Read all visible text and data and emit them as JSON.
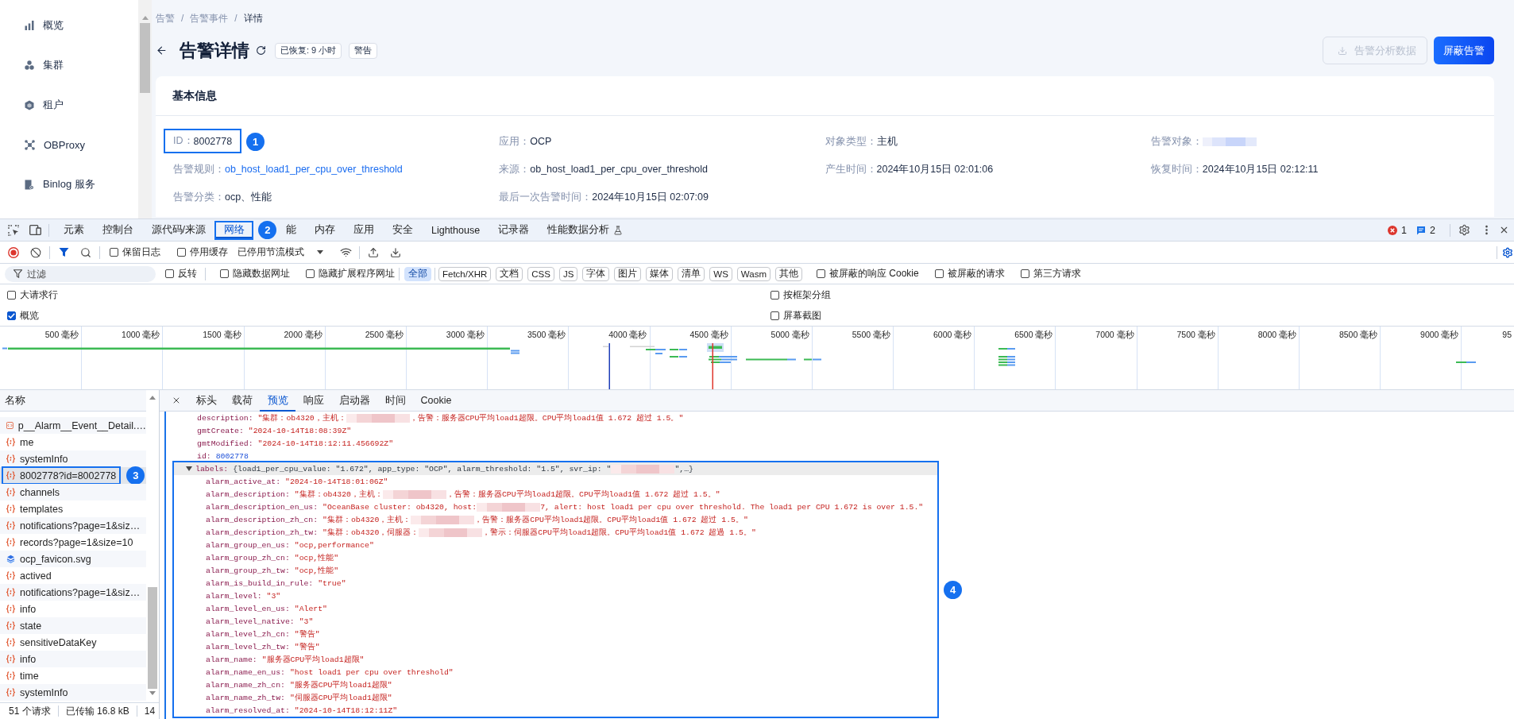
{
  "sidebar": {
    "items": [
      {
        "label": "概览",
        "selected": false
      },
      {
        "label": "集群",
        "selected": false
      },
      {
        "label": "租户",
        "selected": false
      },
      {
        "label": "OBProxy",
        "selected": false
      },
      {
        "label": "Binlog 服务",
        "selected": false
      }
    ]
  },
  "breadcrumb": {
    "items": [
      "告警",
      "告警事件",
      "详情"
    ],
    "separator": "/"
  },
  "header": {
    "title": "告警详情",
    "tags": [
      "已恢复: 9 小时",
      "警告"
    ],
    "actions": [
      {
        "label": "告警分析数据",
        "kind": "default",
        "disabled": true
      },
      {
        "label": "屏蔽告警",
        "kind": "primary",
        "disabled": false
      }
    ]
  },
  "basic_info": {
    "title": "基本信息",
    "fields": [
      {
        "label": "ID：",
        "value": "8002778",
        "kind": "text",
        "callout": "1"
      },
      {
        "label": "应用：",
        "value": "OCP",
        "kind": "text"
      },
      {
        "label": "对象类型：",
        "value": "主机",
        "kind": "text"
      },
      {
        "label": "告警对象：",
        "kind": "redacted"
      },
      {
        "label": "告警规则：",
        "value": "ob_host_load1_per_cpu_over_threshold",
        "kind": "link"
      },
      {
        "label": "来源：",
        "value": "ob_host_load1_per_cpu_over_threshold",
        "kind": "text"
      },
      {
        "label": "产生时间：",
        "value": "2024年10月15日 02:01:06",
        "kind": "text"
      },
      {
        "label": "恢复时间：",
        "value": "2024年10月15日 02:12:11",
        "kind": "text"
      },
      {
        "label": "告警分类：",
        "value": "ocp、性能",
        "kind": "text"
      },
      {
        "label": "最后一次告警时间：",
        "value": "2024年10月15日 02:07:09",
        "kind": "text"
      }
    ]
  },
  "devtools": {
    "tabs": [
      {
        "label": "元素",
        "selected": false,
        "kind": "plain"
      },
      {
        "label": "控制台",
        "selected": false,
        "kind": "plain"
      },
      {
        "label": "源代码/来源",
        "selected": false,
        "kind": "plain"
      },
      {
        "label": "网络",
        "selected": true,
        "kind": "plain",
        "callout": "2"
      },
      {
        "label": "能",
        "selected": false,
        "kind": "plain"
      },
      {
        "label": "内存",
        "selected": false,
        "kind": "plain"
      },
      {
        "label": "应用",
        "selected": false,
        "kind": "plain"
      },
      {
        "label": "安全",
        "selected": false,
        "kind": "plain"
      },
      {
        "label": "Lighthouse",
        "selected": false,
        "kind": "plain"
      },
      {
        "label": "记录器",
        "selected": false,
        "kind": "plain"
      },
      {
        "label": "性能数据分析",
        "selected": false,
        "kind": "experimental"
      }
    ],
    "issue_counts": {
      "errors": "1",
      "messages": "2"
    },
    "toolbar": {
      "options": [
        {
          "label": "保留日志",
          "checked": false
        },
        {
          "label": "停用缓存",
          "checked": false
        }
      ],
      "throttling": "已停用节流模式"
    },
    "filter_bar": {
      "placeholder": "过滤",
      "options": [
        {
          "label": "反转",
          "checked": false
        },
        {
          "label": "隐藏数据网址",
          "checked": false
        },
        {
          "label": "隐藏扩展程序网址",
          "checked": false
        }
      ],
      "types": [
        {
          "label": "全部",
          "selected": true
        },
        {
          "label": "Fetch/XHR",
          "selected": false
        },
        {
          "label": "文档",
          "selected": false
        },
        {
          "label": "CSS",
          "selected": false
        },
        {
          "label": "JS",
          "selected": false
        },
        {
          "label": "字体",
          "selected": false
        },
        {
          "label": "图片",
          "selected": false
        },
        {
          "label": "媒体",
          "selected": false
        },
        {
          "label": "清单",
          "selected": false
        },
        {
          "label": "WS",
          "selected": false
        },
        {
          "label": "Wasm",
          "selected": false
        },
        {
          "label": "其他",
          "selected": false
        }
      ],
      "more_options": [
        {
          "label": "被屏蔽的响应 Cookie",
          "checked": false
        },
        {
          "label": "被屏蔽的请求",
          "checked": false
        },
        {
          "label": "第三方请求",
          "checked": false
        }
      ]
    },
    "settings": [
      {
        "label": "大请求行",
        "checked": false
      },
      {
        "label": "按框架分组",
        "checked": false
      },
      {
        "label": "概览",
        "checked": true
      },
      {
        "label": "屏幕截图",
        "checked": false
      }
    ],
    "overview": {
      "ticks": [
        "500 毫秒",
        "1000 毫秒",
        "1500 毫秒",
        "2000 毫秒",
        "2500 毫秒",
        "3000 毫秒",
        "3500 毫秒",
        "4000 毫秒",
        "4500 毫秒",
        "5000 毫秒",
        "5500 毫秒",
        "6000 毫秒",
        "6500 毫秒",
        "7000 毫秒",
        "7500 毫秒",
        "8000 毫秒",
        "8500 毫秒",
        "9000 毫秒",
        "95"
      ]
    },
    "requests": {
      "header": "名称",
      "rows": [
        {
          "name": "p__Alarm__Event__Detail.…",
          "kind": "script",
          "selected": false
        },
        {
          "name": "me",
          "kind": "fetch",
          "selected": false
        },
        {
          "name": "systemInfo",
          "kind": "fetch",
          "selected": false
        },
        {
          "name": "8002778?id=8002778",
          "kind": "fetch",
          "selected": true,
          "callout": "3"
        },
        {
          "name": "channels",
          "kind": "fetch",
          "selected": false
        },
        {
          "name": "templates",
          "kind": "fetch",
          "selected": false
        },
        {
          "name": "notifications?page=1&siz…",
          "kind": "fetch",
          "selected": false
        },
        {
          "name": "records?page=1&size=10",
          "kind": "fetch",
          "selected": false
        },
        {
          "name": "ocp_favicon.svg",
          "kind": "image",
          "selected": false
        },
        {
          "name": "actived",
          "kind": "fetch",
          "selected": false
        },
        {
          "name": "notifications?page=1&siz…",
          "kind": "fetch",
          "selected": false
        },
        {
          "name": "info",
          "kind": "fetch",
          "selected": false
        },
        {
          "name": "state",
          "kind": "fetch",
          "selected": false
        },
        {
          "name": "sensitiveDataKey",
          "kind": "fetch",
          "selected": false
        },
        {
          "name": "info",
          "kind": "fetch",
          "selected": false
        },
        {
          "name": "time",
          "kind": "fetch",
          "selected": false
        },
        {
          "name": "systemInfo",
          "kind": "fetch",
          "selected": false
        }
      ],
      "status": [
        "51 个请求",
        "已传输 16.8 kB",
        "14"
      ]
    },
    "preview": {
      "tabs": [
        {
          "label": "标头",
          "selected": false
        },
        {
          "label": "载荷",
          "selected": false
        },
        {
          "label": "预览",
          "selected": true
        },
        {
          "label": "响应",
          "selected": false
        },
        {
          "label": "启动器",
          "selected": false
        },
        {
          "label": "时间",
          "selected": false
        },
        {
          "label": "Cookie",
          "selected": false
        }
      ],
      "properties": [
        {
          "key": "description:",
          "selected": false,
          "parts": [
            {
              "kind": "string",
              "text": "\"集群：ob4320，主机："
            },
            {
              "kind": "redacted"
            },
            {
              "kind": "string",
              "text": "，告警：服务器CPU平均load1超限。CPU平均load1值 1.672 超过 1.5。\""
            }
          ]
        },
        {
          "key": "gmtCreate:",
          "selected": false,
          "parts": [
            {
              "kind": "string",
              "text": "\"2024-10-14T18:08:39Z\""
            }
          ]
        },
        {
          "key": "gmtModified:",
          "selected": false,
          "parts": [
            {
              "kind": "string",
              "text": "\"2024-10-14T18:12:11.456692Z\""
            }
          ]
        },
        {
          "key": "id:",
          "selected": false,
          "parts": [
            {
              "kind": "number",
              "text": "8002778"
            }
          ]
        },
        {
          "key": "labels:",
          "selected": true,
          "expanded": true,
          "callout": "4",
          "parts": [
            {
              "kind": "plain",
              "text": "{load1_per_cpu_value: \"1.672\", app_type: \"OCP\", alarm_threshold: \"1.5\", svr_ip: \""
            },
            {
              "kind": "redacted"
            },
            {
              "kind": "plain",
              "text": "\",…}"
            }
          ],
          "children": [
            {
              "key": "alarm_active_at:",
              "selected": false,
              "parts": [
                {
                  "kind": "string",
                  "text": "\"2024-10-14T18:01:06Z\""
                }
              ]
            },
            {
              "key": "alarm_description:",
              "selected": false,
              "parts": [
                {
                  "kind": "string",
                  "text": "\"集群：ob4320，主机："
                },
                {
                  "kind": "redacted"
                },
                {
                  "kind": "string",
                  "text": "，告警：服务器CPU平均load1超限。CPU平均load1值 1.672 超过 1.5。\""
                }
              ]
            },
            {
              "key": "alarm_description_en_us:",
              "selected": false,
              "parts": [
                {
                  "kind": "string",
                  "text": "\"OceanBase cluster: ob4320, host:"
                },
                {
                  "kind": "redacted"
                },
                {
                  "kind": "string",
                  "text": "7, alert: host load1 per cpu over threshold. The load1 per CPU 1.672 is over 1.5.\""
                }
              ]
            },
            {
              "key": "alarm_description_zh_cn:",
              "selected": false,
              "parts": [
                {
                  "kind": "string",
                  "text": "\"集群：ob4320，主机："
                },
                {
                  "kind": "redacted"
                },
                {
                  "kind": "string",
                  "text": "，告警：服务器CPU平均load1超限。CPU平均load1值 1.672 超过 1.5。\""
                }
              ]
            },
            {
              "key": "alarm_description_zh_tw:",
              "selected": false,
              "parts": [
                {
                  "kind": "string",
                  "text": "\"集群：ob4320，伺服器："
                },
                {
                  "kind": "redacted"
                },
                {
                  "kind": "string",
                  "text": "，警示：伺服器CPU平均load1超限。CPU平均load1值 1.672 超過 1.5。\""
                }
              ]
            },
            {
              "key": "alarm_group_en_us:",
              "selected": false,
              "parts": [
                {
                  "kind": "string",
                  "text": "\"ocp,performance\""
                }
              ]
            },
            {
              "key": "alarm_group_zh_cn:",
              "selected": false,
              "parts": [
                {
                  "kind": "string",
                  "text": "\"ocp,性能\""
                }
              ]
            },
            {
              "key": "alarm_group_zh_tw:",
              "selected": false,
              "parts": [
                {
                  "kind": "string",
                  "text": "\"ocp,性能\""
                }
              ]
            },
            {
              "key": "alarm_is_build_in_rule:",
              "selected": false,
              "parts": [
                {
                  "kind": "string",
                  "text": "\"true\""
                }
              ]
            },
            {
              "key": "alarm_level:",
              "selected": false,
              "parts": [
                {
                  "kind": "string",
                  "text": "\"3\""
                }
              ]
            },
            {
              "key": "alarm_level_en_us:",
              "selected": false,
              "parts": [
                {
                  "kind": "string",
                  "text": "\"Alert\""
                }
              ]
            },
            {
              "key": "alarm_level_native:",
              "selected": false,
              "parts": [
                {
                  "kind": "string",
                  "text": "\"3\""
                }
              ]
            },
            {
              "key": "alarm_level_zh_cn:",
              "selected": false,
              "parts": [
                {
                  "kind": "string",
                  "text": "\"警告\""
                }
              ]
            },
            {
              "key": "alarm_level_zh_tw:",
              "selected": false,
              "parts": [
                {
                  "kind": "string",
                  "text": "\"警告\""
                }
              ]
            },
            {
              "key": "alarm_name:",
              "selected": false,
              "parts": [
                {
                  "kind": "string",
                  "text": "\"服务器CPU平均load1超限\""
                }
              ]
            },
            {
              "key": "alarm_name_en_us:",
              "selected": false,
              "parts": [
                {
                  "kind": "string",
                  "text": "\"host load1 per cpu over threshold\""
                }
              ]
            },
            {
              "key": "alarm_name_zh_cn:",
              "selected": false,
              "parts": [
                {
                  "kind": "string",
                  "text": "\"服务器CPU平均load1超限\""
                }
              ]
            },
            {
              "key": "alarm_name_zh_tw:",
              "selected": false,
              "parts": [
                {
                  "kind": "string",
                  "text": "\"伺服器CPU平均load1超限\""
                }
              ]
            },
            {
              "key": "alarm_resolved_at:",
              "selected": false,
              "parts": [
                {
                  "kind": "string",
                  "text": "\"2024-10-14T18:12:11Z\""
                }
              ]
            }
          ]
        }
      ]
    }
  }
}
